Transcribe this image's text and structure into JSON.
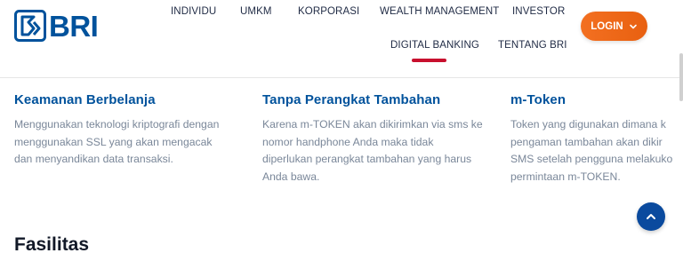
{
  "brand": {
    "logo_text": "BRI",
    "color": "#00529c"
  },
  "nav": {
    "items": [
      {
        "label": "INDIVIDU"
      },
      {
        "label": "UMKM"
      },
      {
        "label": "KORPORASI"
      },
      {
        "label": "WEALTH MANAGEMENT"
      },
      {
        "label": "INVESTOR"
      },
      {
        "label": "DIGITAL BANKING",
        "active": true
      },
      {
        "label": "TENTANG BRI"
      }
    ],
    "active_indicator_color": "#c8102e"
  },
  "login": {
    "label": "LOGIN",
    "icon": "chevron-down-icon",
    "color": "#f37021"
  },
  "features": [
    {
      "title": "Keamanan Berbelanja",
      "lines": [
        "Menggunakan teknologi kriptografi dengan",
        "menggunakan SSL yang akan mengacak",
        "dan menyandikan data transaksi."
      ]
    },
    {
      "title": "Tanpa Perangkat Tambahan",
      "lines": [
        "Karena m-TOKEN akan dikirimkan via sms ke",
        "nomor handphone Anda maka tidak",
        "diperlukan perangkat tambahan yang harus",
        "Anda bawa."
      ]
    },
    {
      "title": "m-Token",
      "lines": [
        "Token yang digunakan dimana k",
        "pengaman tambahan akan dikir",
        "SMS setelah pengguna melakuko",
        "permintaan m-TOKEN."
      ]
    }
  ],
  "section_heading": "Fasilitas",
  "scroll_top": {
    "icon": "chevron-up-icon",
    "color": "#0a4a9e"
  }
}
